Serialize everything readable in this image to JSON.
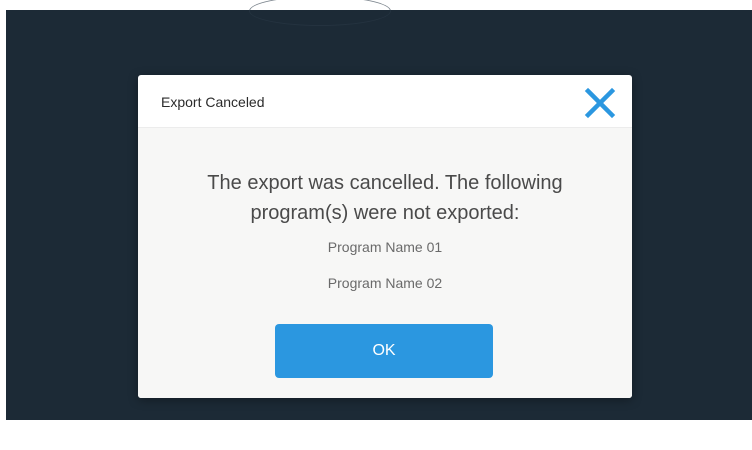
{
  "dialog": {
    "title": "Export Canceled",
    "close_icon": "close-x-icon",
    "message": "The export was cancelled. The following program(s) were not exported:",
    "programs": [
      "Program Name 01",
      "Program Name 02"
    ],
    "ok_label": "OK"
  },
  "colors": {
    "overlay_background": "#1c2a36",
    "dialog_background": "#ffffff",
    "body_background": "#f7f7f6",
    "accent": "#2b97e0",
    "close_icon": "#2b97e0",
    "button_text": "#ffffff"
  }
}
